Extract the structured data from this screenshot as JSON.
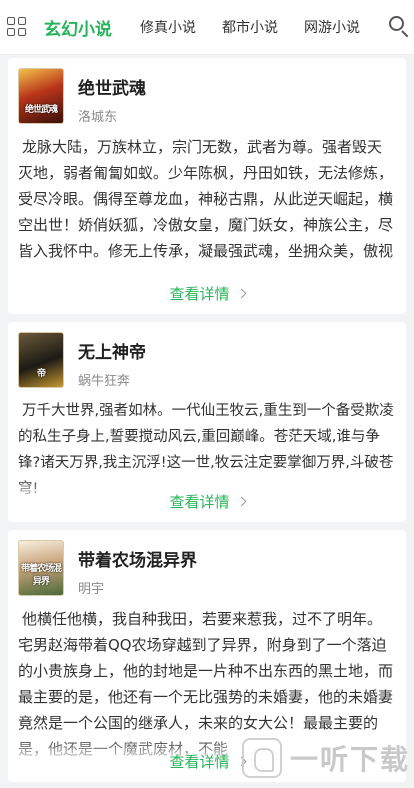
{
  "header": {
    "tabs": [
      {
        "label": "玄幻小说",
        "active": true
      },
      {
        "label": "修真小说",
        "active": false
      },
      {
        "label": "都市小说",
        "active": false
      },
      {
        "label": "网游小说",
        "active": false
      }
    ]
  },
  "books": [
    {
      "title": "绝世武魂",
      "author": "洛城东",
      "cover_text": "绝世武魂",
      "description": "龙脉大陆，万族林立，宗门无数，武者为尊。强者毁天灭地，弱者匍匐如蚁。少年陈枫，丹田如铁，无法修炼，受尽冷眼。偶得至尊龙血，神秘古鼎，从此逆天崛起，横空出世！娇俏妖狐，冷傲女皇，魔门妖女，神族公主，尽皆入我怀中。修无上传承，凝最强武魂，坐拥众美，傲视",
      "more_label": "查看详情"
    },
    {
      "title": "无上神帝",
      "author": "蜗牛狂奔",
      "cover_text": "帝",
      "description": "万千大世界,强者如林。一代仙王牧云,重生到一个备受欺凌的私生子身上,誓要搅动风云,重回巅峰。苍茫天域,谁与争锋?诸天万界,我主沉浮!这一世,牧云注定要掌御万界,斗破苍穹!",
      "more_label": "查看详情"
    },
    {
      "title": "带着农场混异界",
      "author": "明宇",
      "cover_text": "带着农场混异界",
      "description": "他横任他横，我自种我田，若要来惹我，过不了明年。 宅男赵海带着QQ农场穿越到了异界，附身到了一个落迫的小贵族身上，他的封地是一片种不出东西的黑土地，而最主要的是，他还有一个无比强势的未婚妻，他的未婚妻竟然是一个公国的继承人，未来的女大公！最最主要的是，他还是一个魔武废材，不能",
      "more_label": "查看详情"
    }
  ],
  "watermark": {
    "text": "一听下载"
  }
}
